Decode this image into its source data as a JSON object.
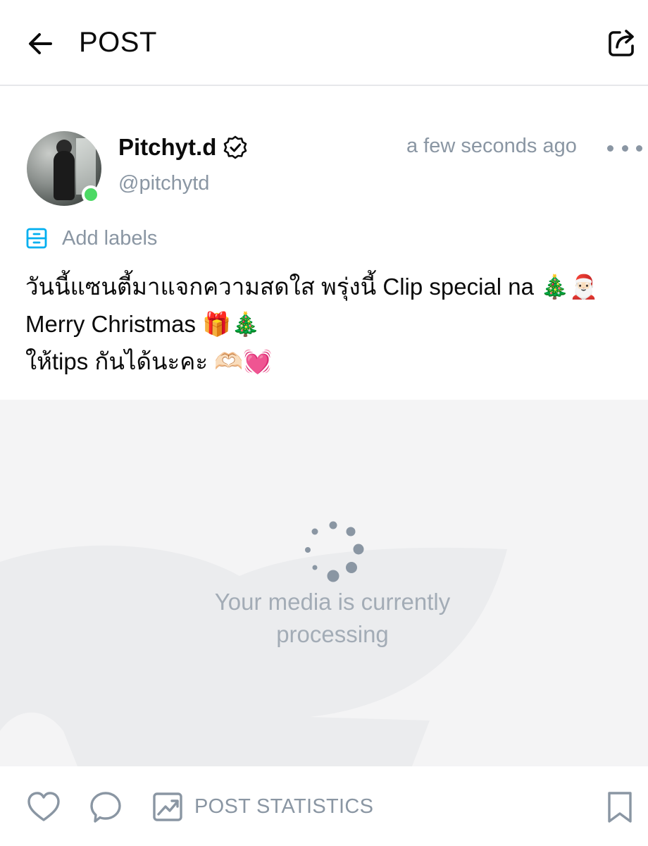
{
  "header": {
    "title": "POST",
    "back_icon": "arrow-left-icon",
    "share_icon": "share-icon"
  },
  "post": {
    "author": {
      "name": "Pitchyt.d",
      "handle": "@pitchytd",
      "verified": true,
      "online": true
    },
    "timestamp": "a few seconds ago",
    "more_icon": "more-dots-icon",
    "labels": {
      "label": "Add labels",
      "icon": "labels-icon"
    },
    "caption": {
      "line1": "วันนี้แซนตี้มาแจกความสดใส พรุ่งนี้ Clip special na 🎄🎅🏻",
      "line2": "Merry Christmas 🎁🎄",
      "line3": "ให้tips กันได้นะคะ 🫶🏻💓"
    },
    "media": {
      "status": "Your media is currently processing"
    }
  },
  "actions": {
    "like_icon": "heart-icon",
    "comment_icon": "comment-icon",
    "stats_icon": "chart-icon",
    "stats_label": "POST STATISTICS",
    "bookmark_icon": "bookmark-icon"
  },
  "colors": {
    "text_primary": "#0b0b0b",
    "text_secondary": "#8a96a3",
    "accent_blue": "#00aff0",
    "online_green": "#4cd964",
    "media_bg": "#f4f4f5"
  }
}
